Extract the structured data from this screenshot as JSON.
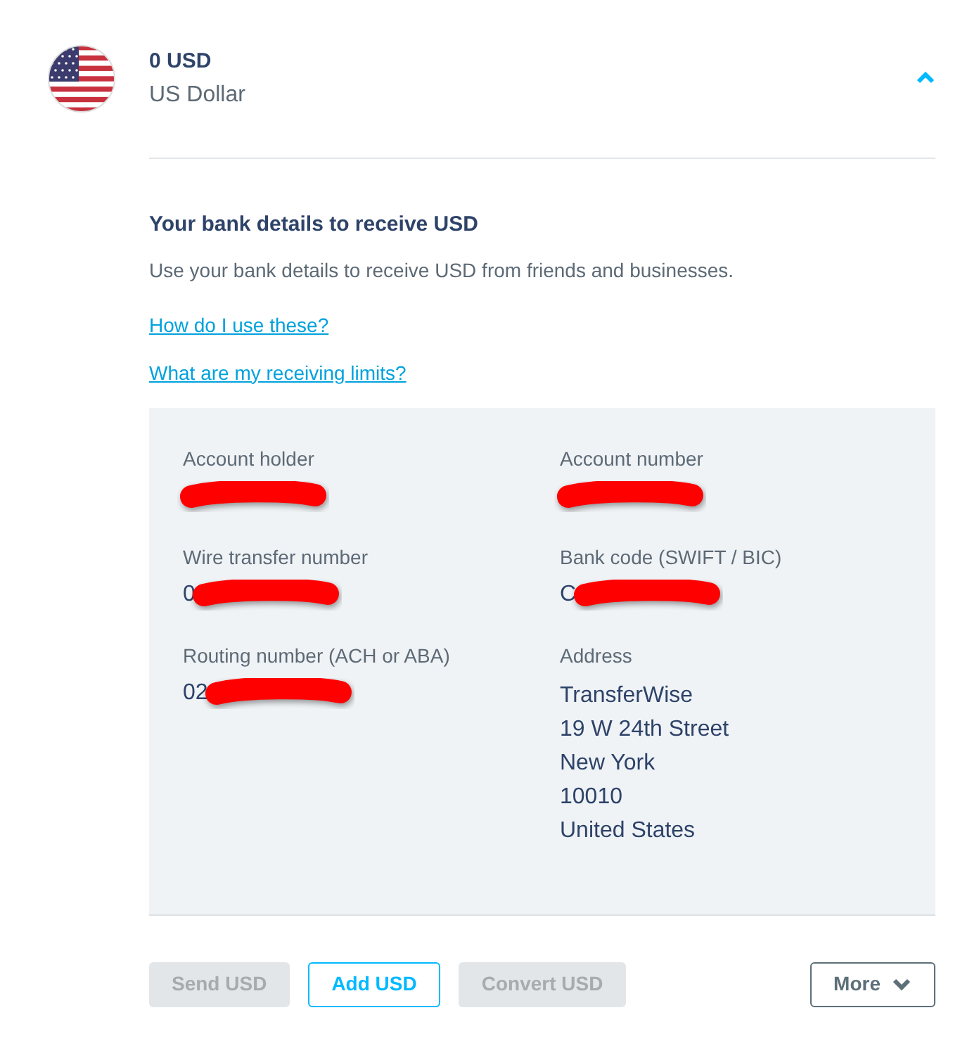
{
  "balance": {
    "amount": "0 USD",
    "currency": "US Dollar",
    "expanded": true
  },
  "bank_details": {
    "title": "Your bank details to receive USD",
    "description": "Use your bank details to receive USD from friends and businesses.",
    "links": [
      "How do I use these?",
      "What are my receiving limits?"
    ],
    "fields": [
      {
        "label": "Account holder",
        "redacted": true
      },
      {
        "label": "Account number",
        "redacted": true
      },
      {
        "label": "Wire transfer number",
        "value": "0",
        "redacted": true
      },
      {
        "label": "Bank code (SWIFT / BIC)",
        "value": "C",
        "redacted": true
      },
      {
        "label": "Routing number (ACH or ABA)",
        "value": "02",
        "redacted": true
      },
      {
        "label": "Address",
        "lines": [
          "TransferWise",
          "19 W 24th Street",
          "New York",
          "10010",
          "United States"
        ]
      }
    ]
  },
  "actions": [
    {
      "label": "Send USD",
      "kind": "solid",
      "disabled": true
    },
    {
      "label": "Add USD",
      "kind": "outline",
      "disabled": false
    },
    {
      "label": "Convert USD",
      "kind": "solid",
      "disabled": true
    },
    {
      "label": "More",
      "kind": "dropdown",
      "disabled": false
    }
  ]
}
